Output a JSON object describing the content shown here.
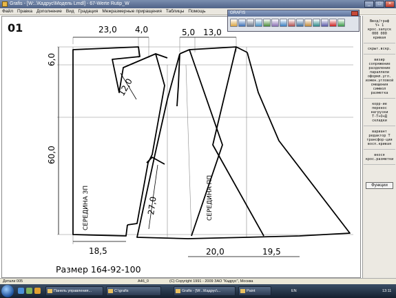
{
  "window": {
    "title": "Grafis - [W:..\\Кадрус\\Модель Lmdl] - 67-Werte Rutip_W"
  },
  "menu": [
    "Файл",
    "Правка",
    "Дополнение",
    "Вид",
    "Градация",
    "Межразмерные приращения",
    "Таблицы",
    "Помощь"
  ],
  "drawing": {
    "figure_number": "01",
    "dims": {
      "top_a": "23,0",
      "top_b": "4,0",
      "top_c": "5,0",
      "top_d": "13,0",
      "left_a": "6,0",
      "left_b": "60,0",
      "dart": "12,0",
      "pocket": "27,0",
      "bottom_a": "18,5",
      "bottom_b": "20,0",
      "bottom_c": "19,5"
    },
    "labels": {
      "back_center": "СЕРЕДИНА ЗП",
      "front_center": "СЕРЕДИНА ПП"
    },
    "size": "Размер 164-92-100"
  },
  "toolbar": {
    "title": "GRAFIS",
    "tools": [
      "open-icon",
      "save-icon",
      "print-icon",
      "zoom-icon",
      "measure-icon",
      "grid-icon",
      "settings-icon",
      "layers-icon",
      "module-icon",
      "color-icon",
      "export-icon",
      "tools-icon",
      "stop-icon",
      "monitor-icon"
    ],
    "tool_colors": [
      "#d9a441",
      "#3b6fb6",
      "#6d7a8c",
      "#4a90c0",
      "#4b8c3a",
      "#8a6fb3",
      "#3a7fc0",
      "#b05050",
      "#3c6e9c",
      "#c08a3a",
      "#2e8a8a",
      "#5a5aa8",
      "#cc2222",
      "#3a9a4a"
    ]
  },
  "side_panel": {
    "groups": [
      [
        "Ввод/граф",
        "Y+   1",
        "крос.запуск",
        "000 000",
        "кривая"
      ],
      [
        "скрыт.вскр."
      ],
      [
        "визир",
        "сопряжение",
        "разделение",
        "параллели",
        "оформл.угл.",
        "измен.угловой",
        "смещения",
        "символ",
        "разметка"
      ],
      [
        "корр-ие",
        "перенос",
        "нагрузки",
        "Т-Т+О+Д",
        "складки"
      ],
      [
        "вариант",
        "редактор Т",
        "трансфор-ция",
        "восп.кривая"
      ],
      [
        "вкося",
        "крос.разметки"
      ]
    ],
    "button": "Функции"
  },
  "status": {
    "left": "Детали 005",
    "mid": "A46_0",
    "copyright": "(C) Copyright 1991 - 2009 ЗАО \"Кадрус\", Москва"
  },
  "taskbar": {
    "tasks": [
      "Панель управления...",
      "C:\\grafis",
      "Grafis - [W:..\\Кадрус\\...",
      "Paint"
    ],
    "lang": "EN",
    "clock": "13:11"
  }
}
